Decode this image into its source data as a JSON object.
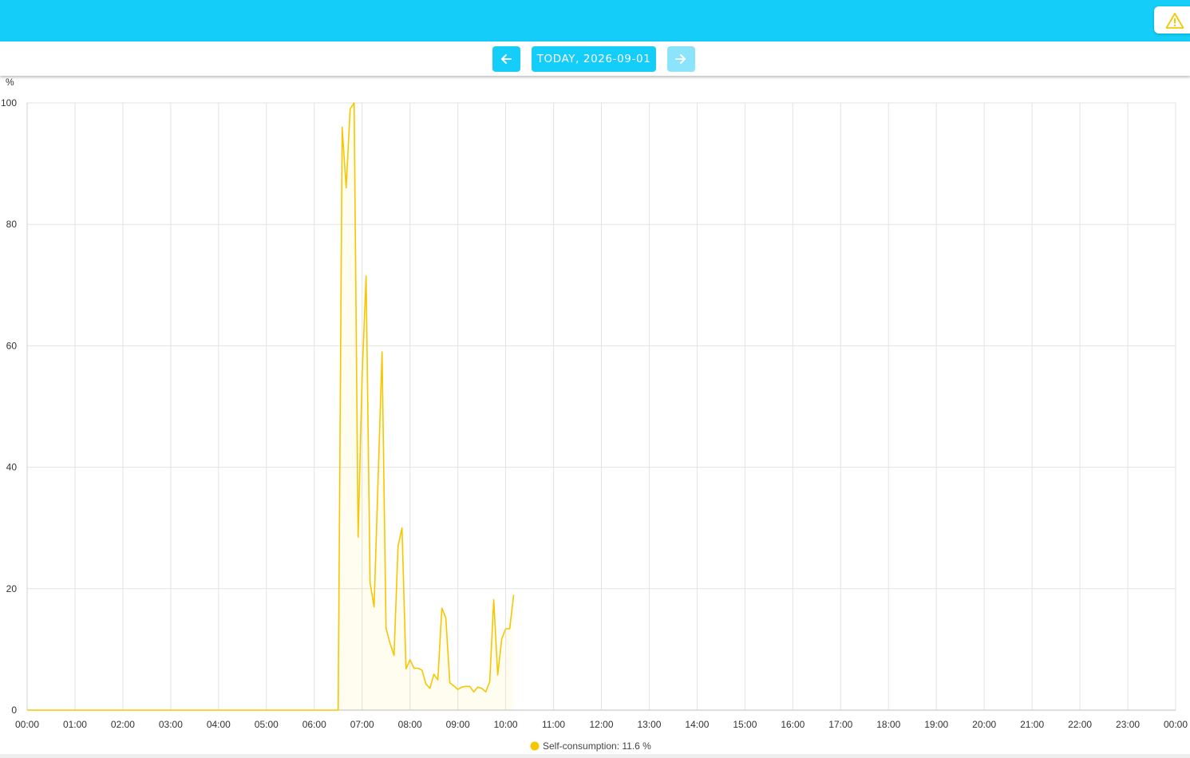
{
  "header": {
    "alert_icon": "warning-triangle-icon",
    "alert_color": "#f7c600"
  },
  "date_nav": {
    "prev_icon": "arrow-left-icon",
    "next_icon": "arrow-right-icon",
    "date_label": "TODAY, 2026-09-01",
    "next_disabled": true
  },
  "colors": {
    "accent": "#14cdf8",
    "accent_disabled": "#8be4fb",
    "series": "#f7c600"
  },
  "chart_data": {
    "type": "line",
    "ylabel": "%",
    "ylim": [
      0,
      100
    ],
    "yticks": [
      "0",
      "20",
      "40",
      "60",
      "80",
      "100"
    ],
    "xlim": [
      "00:00",
      "24:00"
    ],
    "xticks": [
      "00:00",
      "01:00",
      "02:00",
      "03:00",
      "04:00",
      "05:00",
      "06:00",
      "07:00",
      "08:00",
      "09:00",
      "10:00",
      "11:00",
      "12:00",
      "13:00",
      "14:00",
      "15:00",
      "16:00",
      "17:00",
      "18:00",
      "19:00",
      "20:00",
      "21:00",
      "22:00",
      "23:00",
      "00:00"
    ],
    "grid": true,
    "legend_position": "bottom-center",
    "series": [
      {
        "name": "Self-consumption: 11.6 %",
        "color": "#f7c600",
        "fill": "area",
        "x": [
          "00:00",
          "06:30",
          "06:35",
          "06:40",
          "06:45",
          "06:50",
          "06:55",
          "07:00",
          "07:05",
          "07:10",
          "07:15",
          "07:20",
          "07:25",
          "07:30",
          "07:35",
          "07:40",
          "07:45",
          "07:50",
          "07:55",
          "08:00",
          "08:05",
          "08:10",
          "08:15",
          "08:20",
          "08:25",
          "08:30",
          "08:35",
          "08:40",
          "08:45",
          "08:50",
          "08:55",
          "09:00",
          "09:05",
          "09:10",
          "09:15",
          "09:20",
          "09:25",
          "09:30",
          "09:35",
          "09:40",
          "09:45",
          "09:50",
          "09:55",
          "10:00",
          "10:05",
          "10:10"
        ],
        "y": [
          0,
          0,
          96,
          86,
          99,
          100,
          28.5,
          55,
          71.5,
          21,
          17,
          38,
          59,
          13.5,
          11,
          9,
          27,
          30,
          6.8,
          8.3,
          6.9,
          6.9,
          6.6,
          4.3,
          3.6,
          5.9,
          5,
          16.8,
          15.2,
          4.5,
          4,
          3.4,
          3.8,
          3.9,
          3.9,
          3,
          3.8,
          3.6,
          3,
          4.7,
          18.2,
          5.8,
          11.7,
          13.4,
          13.4,
          19
        ]
      }
    ]
  }
}
